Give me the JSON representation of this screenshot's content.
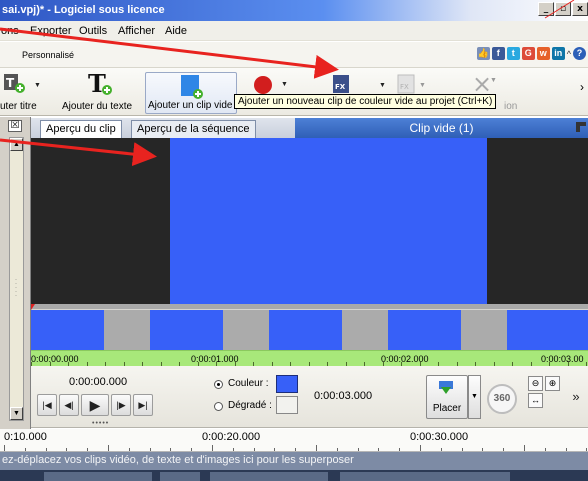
{
  "window": {
    "title": "sai.vpj)* - Logiciel sous licence",
    "min_glyph": "_",
    "max_glyph": "▫",
    "close_glyph": "x"
  },
  "menu": {
    "items": [
      "ons",
      "Exporter",
      "Outils",
      "Afficher",
      "Aide"
    ]
  },
  "ribbon": {
    "tab_label": "Personnalisé",
    "social_icons": [
      "like-icon",
      "facebook-icon",
      "twitter-icon",
      "googleplus-icon",
      "weibo-icon",
      "linkedin-icon"
    ],
    "social_glyphs": [
      "👍",
      "f",
      "t",
      "G",
      "w",
      "in"
    ],
    "chevron_glyph": "^",
    "help_glyph": "?"
  },
  "toolbar": {
    "add_title": "uter titre",
    "add_text": "Ajouter du texte",
    "add_clip": "Ajouter un clip vide",
    "add_clip_suffix": "ion",
    "close_glyph": "×"
  },
  "tooltip": {
    "text": "Ajouter un nouveau clip de couleur vide au projet (Ctrl+K)"
  },
  "preview_tabs": {
    "clip_tab": "Aperçu du clip",
    "sequence_tab": "Aperçu de la séquence",
    "clip_name": "Clip vide (1)"
  },
  "clip_timeline": {
    "timecodes": [
      "0:00:00.000",
      "0:00:01.000",
      "0:00:02.000",
      "0:00:03.00"
    ],
    "segment_pattern": [
      "blue",
      "gray",
      "blue",
      "gray",
      "blue",
      "gray",
      "blue",
      "gray",
      "blue"
    ]
  },
  "controls": {
    "current_time": "0:00:00.000",
    "color_label": "Couleur :",
    "gradient_label": "Dégradé :",
    "duration": "0:00:03.000",
    "placer_label": "Placer",
    "rotate_label": "360",
    "more_glyph": "»",
    "grip": "•••••"
  },
  "track_ruler": {
    "timecodes": [
      "0:10.000",
      "0:00:20.000",
      "0:00:30.000"
    ]
  },
  "overlay_track": {
    "hint": "ez-déplacez vos clips vidéo, de texte et d'images ici pour les superposer"
  },
  "colors": {
    "clip_blue": "#3760f8",
    "preview_bg": "#262626",
    "timeline_gray": "#ababab",
    "ruler_green": "#a8e87a",
    "annotation_red": "#e8231f"
  }
}
